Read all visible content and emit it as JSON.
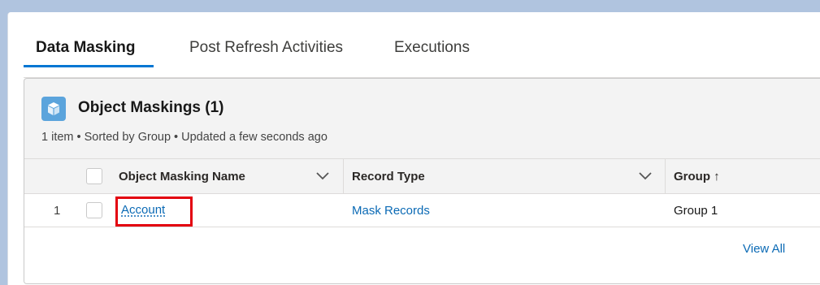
{
  "tabs": [
    {
      "label": "Data Masking",
      "active": true
    },
    {
      "label": "Post Refresh Activities",
      "active": false
    },
    {
      "label": "Executions",
      "active": false
    }
  ],
  "card": {
    "icon": "cube-icon",
    "title": "Object Maskings (1)",
    "meta": "1 item • Sorted by Group • Updated a few seconds ago"
  },
  "table": {
    "columns": [
      {
        "label": "Object Masking Name",
        "sortable_menu": true
      },
      {
        "label": "Record Type",
        "sortable_menu": true
      },
      {
        "label": "Group",
        "sort_indicator": "↑"
      }
    ],
    "rows": [
      {
        "index": "1",
        "name": "Account",
        "record_type": "Mask Records",
        "group": "Group 1",
        "highlighted": true
      }
    ]
  },
  "footer": {
    "view_all": "View All"
  },
  "colors": {
    "accent": "#0176d3",
    "link": "#0b6ab5",
    "highlight": "#e3000f",
    "icon_bg": "#5ba4dc"
  }
}
